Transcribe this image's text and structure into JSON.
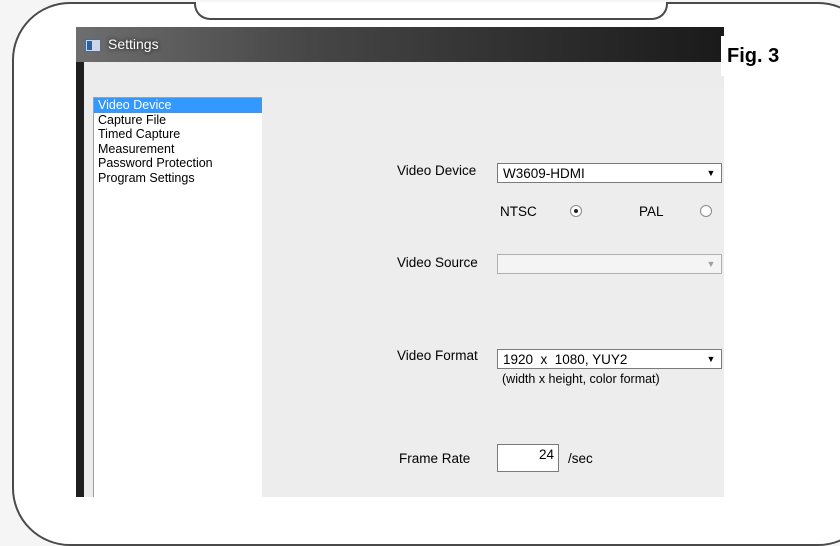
{
  "figure_label": "Fig. 3",
  "window": {
    "title": "Settings"
  },
  "nav": {
    "items": [
      {
        "label": "Video Device",
        "selected": true
      },
      {
        "label": "Capture File",
        "selected": false
      },
      {
        "label": "Timed Capture",
        "selected": false
      },
      {
        "label": "Measurement",
        "selected": false
      },
      {
        "label": "Password Protection",
        "selected": false
      },
      {
        "label": "Program Settings",
        "selected": false
      }
    ]
  },
  "form": {
    "video_device": {
      "label": "Video Device",
      "value": "W3609-HDMI"
    },
    "standard": {
      "ntsc_label": "NTSC",
      "pal_label": "PAL",
      "selected": "NTSC"
    },
    "video_source": {
      "label": "Video Source",
      "value": "",
      "enabled": false
    },
    "video_format": {
      "label": "Video Format",
      "value": "1920  x  1080, YUY2",
      "hint": "(width x height, color format)"
    },
    "frame_rate": {
      "label": "Frame Rate",
      "value": "24",
      "unit": "/sec"
    }
  }
}
